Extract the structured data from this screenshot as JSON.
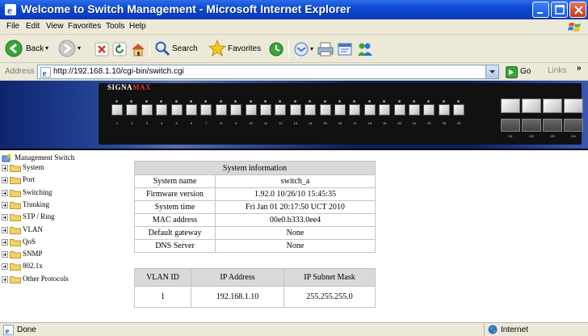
{
  "window": {
    "title": "Welcome to Switch Management - Microsoft Internet Explorer"
  },
  "menu": {
    "items": [
      "File",
      "Edit",
      "View",
      "Favorites",
      "Tools",
      "Help"
    ]
  },
  "toolbar": {
    "back_label": "Back",
    "search_label": "Search",
    "favorites_label": "Favorites"
  },
  "address": {
    "label": "Address",
    "url": "http://192.168.1.10/cgi-bin/switch.cgi",
    "go_label": "Go",
    "links_label": "Links"
  },
  "device": {
    "brand_prefix": "SIGNA",
    "brand_suffix": "MAX",
    "port_numbers": [
      "1",
      "2",
      "3",
      "4",
      "5",
      "6",
      "7",
      "8",
      "9",
      "10",
      "11",
      "12",
      "13",
      "14",
      "15",
      "16",
      "17",
      "18",
      "19",
      "20",
      "21",
      "22",
      "23",
      "24"
    ],
    "sfp_numbers": [
      "G1",
      "G2",
      "G3",
      "G4"
    ]
  },
  "sidebar": {
    "root_label": "Management Switch",
    "items": [
      "System",
      "Port",
      "Switching",
      "Trunking",
      "STP / Ring",
      "VLAN",
      "QoS",
      "SNMP",
      "802.1x",
      "Other Protocols"
    ]
  },
  "system_info": {
    "header": "System information",
    "rows": [
      {
        "label": "System name",
        "value": "switch_a"
      },
      {
        "label": "Firmware version",
        "value": "1.92.0 10/26/10 15:45:35"
      },
      {
        "label": "System time",
        "value": "Fri Jan 01 20:17:50 UCT 2010"
      },
      {
        "label": "MAC address",
        "value": "00e0.b333.0ee4"
      },
      {
        "label": "Default gateway",
        "value": "None"
      },
      {
        "label": "DNS Server",
        "value": "None"
      }
    ]
  },
  "vlan_info": {
    "columns": [
      "VLAN ID",
      "IP Address",
      "IP Subnet Mask"
    ],
    "rows": [
      [
        "1",
        "192.168.1.10",
        "255.255.255.0"
      ]
    ]
  },
  "status": {
    "text": "Done",
    "zone": "Internet"
  },
  "colors": {
    "title_bar": "#0a4bd6",
    "chrome": "#ece9d8",
    "table_header": "#d9d9d9",
    "banner": "#0a1f5e"
  }
}
